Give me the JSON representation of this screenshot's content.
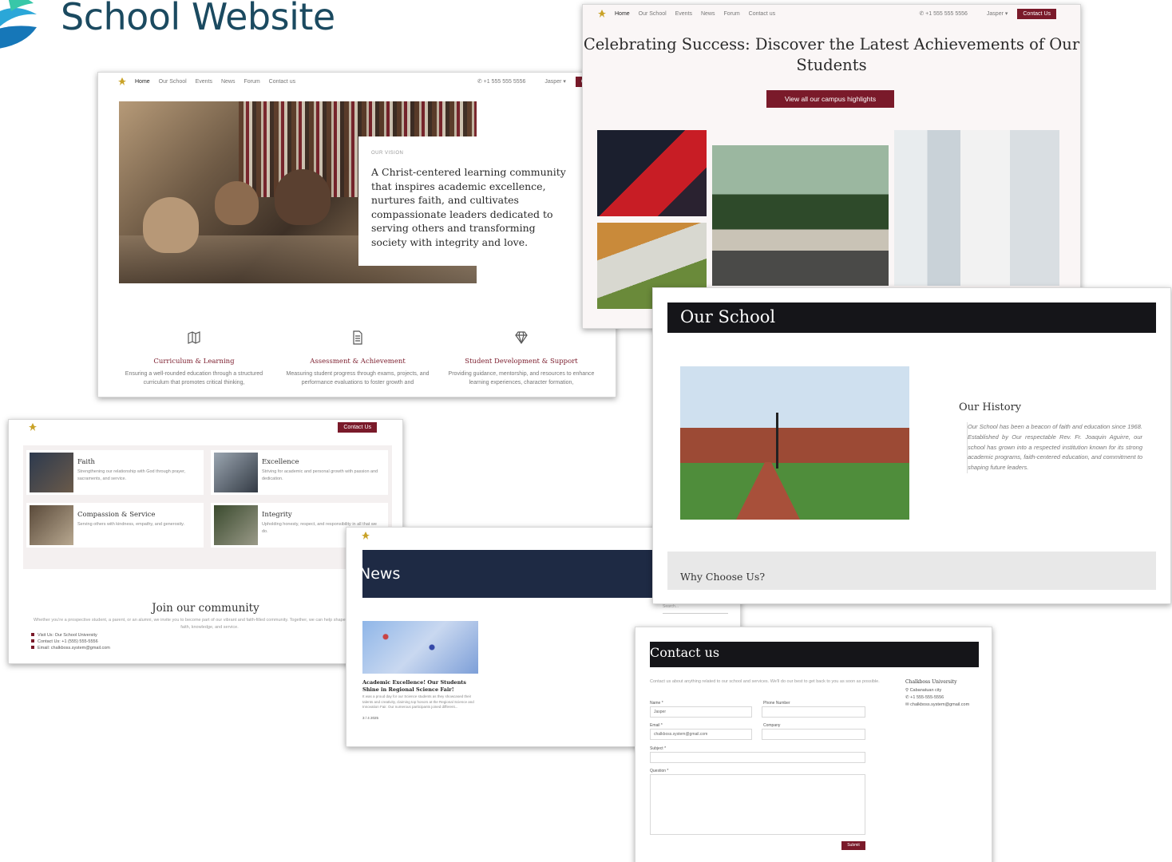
{
  "header": {
    "title": "School Website"
  },
  "nav": {
    "links": [
      "Home",
      "Our School",
      "Events",
      "News",
      "Forum",
      "Contact us"
    ],
    "phone": "+1 555 555 5556",
    "user": "Jasper ▾",
    "contact_btn": "Contact",
    "contact_btn_full": "Contact Us"
  },
  "home": {
    "vision_label": "OUR VISION",
    "vision_text": "A Christ-centered learning community that inspires academic excellence, nurtures faith, and cultivates compassionate leaders dedicated to serving others and transforming society with integrity and love.",
    "features": [
      {
        "icon": "map-icon",
        "title": "Curriculum & Learning",
        "desc": "Ensuring a well-rounded education through a structured curriculum that promotes critical thinking,"
      },
      {
        "icon": "document-icon",
        "title": "Assessment & Achievement",
        "desc": "Measuring student progress through exams, projects, and performance evaluations to foster growth and"
      },
      {
        "icon": "diamond-icon",
        "title": "Student Development & Support",
        "desc": "Providing guidance, mentorship, and resources to enhance learning experiences, character formation,"
      }
    ]
  },
  "achievements": {
    "title": "Celebrating Success: Discover the Latest Achievements of Our Students",
    "cta": "View all our campus highlights"
  },
  "values": {
    "items": [
      {
        "title": "Faith",
        "desc": "Strengthening our relationship with God through prayer, sacraments, and service."
      },
      {
        "title": "Excellence",
        "desc": "Striving for academic and personal growth with passion and dedication."
      },
      {
        "title": "Compassion & Service",
        "desc": "Serving others with kindness, empathy, and generosity."
      },
      {
        "title": "Integrity",
        "desc": "Upholding honesty, respect, and responsibility in all that we do."
      }
    ],
    "join_title": "Join our community",
    "join_desc": "Whether you're a prospective student, a parent, or an alumni, we invite you to become part of our vibrant and faith-filled community. Together, we can help shape your child's future in faith, knowledge, and service.",
    "contact_lines": [
      "Visit Us: Our School University",
      "Contact Us: +1 (555) 555-5556",
      "Email: chalkboss.system@gmail.com"
    ]
  },
  "news": {
    "title": "News",
    "search_placeholder": "Search...",
    "article_title": "Academic Excellence! Our Students Shine in Regional Science Fair!",
    "article_desc": "It was a proud day for our Science students as they showcased their talents and creativity, claiming top honors at the Regional Science and Innovation Fair. Our numerous participants joined different...",
    "article_link": "Read more",
    "article_date": "3 / 4 2025"
  },
  "our_school": {
    "title": "Our School",
    "history_title": "Our History",
    "history_text": "Our School has been a beacon of faith and education since 1968. Established by Our respectable Rev. Fr. Joaquin Aguirre, our school has grown into a respected institution known for its strong academic programs, faith-centered education, and commitment to shaping future leaders.",
    "why_title": "Why Choose Us?"
  },
  "contact": {
    "title": "Contact us",
    "intro": "Contact us about anything related to our school and services. We'll do our best to get back to you as soon as possible.",
    "fields": {
      "name": "Name *",
      "name_value": "Jasper",
      "phone": "Phone Number",
      "email": "Email *",
      "email_value": "chalkboss.system@gmail.com",
      "company": "Company",
      "subject": "Subject *",
      "question": "Question *"
    },
    "submit": "Submit",
    "side_title": "Chalkboss University",
    "side_lines": [
      "Cabanatuan city",
      "+1 555-555-5556",
      "chalkboss.system@gmail.com"
    ]
  },
  "colors": {
    "accent": "#7a1a2a",
    "title": "#1b4a60",
    "dark": "#151519",
    "navy": "#1e2a44"
  }
}
